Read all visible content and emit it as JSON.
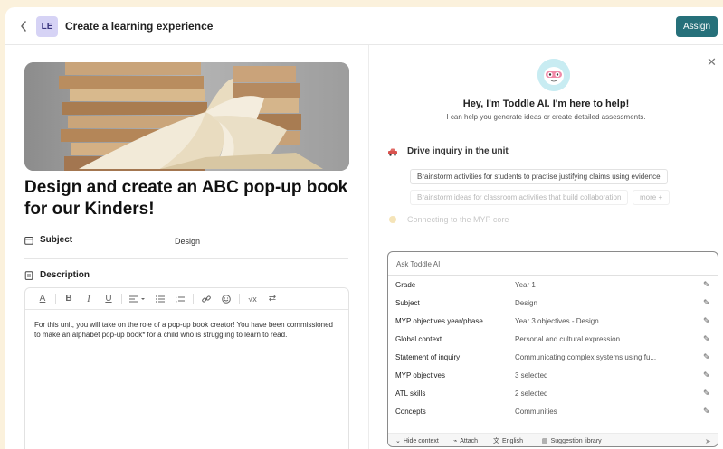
{
  "header": {
    "back_icon": "chevron-left-icon",
    "avatar": "LE",
    "title": "Create a learning experience",
    "assign_label": "Assign"
  },
  "left": {
    "heading": "Design and create an ABC pop-up book for our Kinders!",
    "subject_label": "Subject",
    "subject_value": "Design",
    "description_label": "Description",
    "toolbar_icons": [
      "text-color-icon",
      "bold-icon",
      "italic-icon",
      "underline-icon",
      "align-icon",
      "bullet-list-icon",
      "numbered-list-icon",
      "link-icon",
      "emoji-icon",
      "formula-icon",
      "swap-icon"
    ],
    "description_text": "For this unit, you will take on the role of a pop-up book creator! You have been commissioned to make an alphabet pop-up book* for a child who is struggling to learn to read."
  },
  "right": {
    "greeting": "Hey, I'm Toddle AI. I'm here to help!",
    "subtitle": "I can help you generate ideas or create detailed assessments.",
    "drive_title": "Drive inquiry in the unit",
    "chips": [
      "Brainstorm activities for students to practise justifying claims using evidence",
      "Brainstorm ideas for classroom activities that build collaboration",
      "more +"
    ],
    "connecting": "Connecting to the MYP core",
    "ask_placeholder": "Ask Toddle AI",
    "context": [
      {
        "key": "Grade",
        "value": "Year 1"
      },
      {
        "key": "Subject",
        "value": "Design"
      },
      {
        "key": "MYP objectives year/phase",
        "value": "Year 3 objectives - Design"
      },
      {
        "key": "Global context",
        "value": "Personal and cultural expression"
      },
      {
        "key": "Statement of inquiry",
        "value": "Communicating complex systems using fu..."
      },
      {
        "key": "MYP objectives",
        "value": "3 selected"
      },
      {
        "key": "ATL skills",
        "value": "2 selected"
      },
      {
        "key": "Concepts",
        "value": "Communities"
      }
    ],
    "footer": {
      "hide_context": "Hide context",
      "attach": "Attach",
      "language": "English",
      "suggestion_library": "Suggestion library"
    }
  },
  "colors": {
    "accent": "#26707a",
    "background": "#fbf1dc",
    "avatar_bg": "#d6d3f5"
  }
}
